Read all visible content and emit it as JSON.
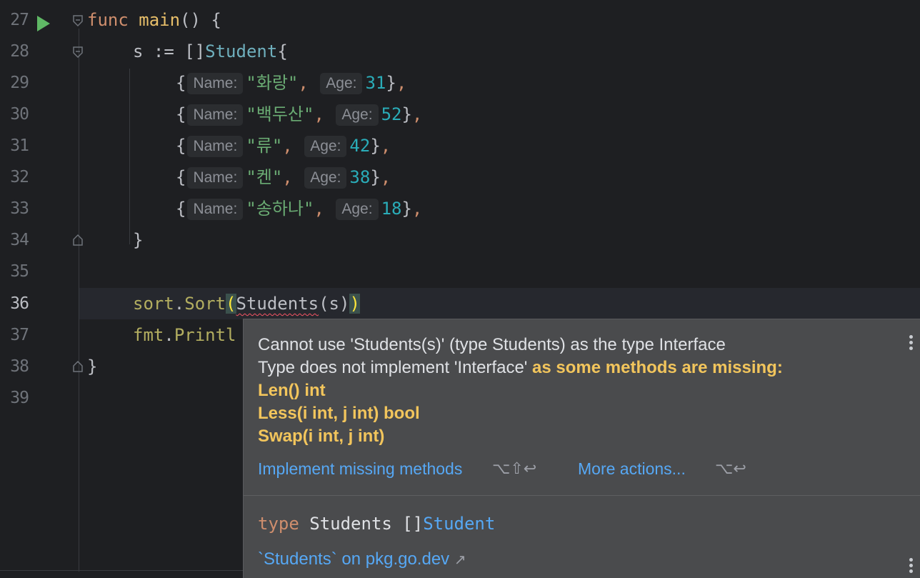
{
  "editor": {
    "line_numbers": [
      "27",
      "28",
      "29",
      "30",
      "31",
      "32",
      "33",
      "34",
      "35",
      "36",
      "37",
      "38",
      "39"
    ],
    "current_line": "36",
    "lines": {
      "l27": {
        "kw": "func",
        "name": "main",
        "rest": "() {"
      },
      "l28": {
        "var": "s",
        "op": " := ",
        "br": "[]",
        "type": "Student",
        "open": "{"
      },
      "rows": [
        {
          "name_hint": "Name:",
          "name": "\"화랑\"",
          "age_hint": "Age:",
          "age": "31"
        },
        {
          "name_hint": "Name:",
          "name": "\"백두산\"",
          "age_hint": "Age:",
          "age": "52"
        },
        {
          "name_hint": "Name:",
          "name": "\"류\"",
          "age_hint": "Age:",
          "age": "42"
        },
        {
          "name_hint": "Name:",
          "name": "\"켄\"",
          "age_hint": "Age:",
          "age": "38"
        },
        {
          "name_hint": "Name:",
          "name": "\"송하나\"",
          "age_hint": "Age:",
          "age": "18"
        }
      ],
      "l34": "}",
      "l36": {
        "pkg": "sort",
        "fn": "Sort",
        "arg_type": "Students",
        "arg": "s"
      },
      "l37": {
        "pkg": "fmt",
        "fn": "Printl"
      },
      "l38": "}"
    }
  },
  "popup": {
    "line1": "Cannot use 'Students(s)' (type Students) as the type Interface",
    "line2_plain": "Type does not implement 'Interface' ",
    "line2_highlight": "as some methods are missing:",
    "methods": [
      "Len() int",
      "Less(i int, j int) bool",
      "Swap(i int, j int)"
    ],
    "action1_label": "Implement missing methods",
    "action1_shortcut": "⌥⇧↩",
    "action2_label": "More actions...",
    "action2_shortcut": "⌥↩",
    "doc_kw": "type",
    "doc_name": " Students []",
    "doc_type": "Student",
    "doc_link": "`Students` on pkg.go.dev",
    "doc_link_arrow": "↗"
  },
  "colors": {
    "background": "#1e1f22",
    "popup_bg": "#4a4b4d",
    "keyword": "#cf8e6d",
    "function": "#56a8f5",
    "string": "#6aab73",
    "number": "#2aacb8",
    "warning": "#f2c55c",
    "run_icon": "#5fb865"
  }
}
